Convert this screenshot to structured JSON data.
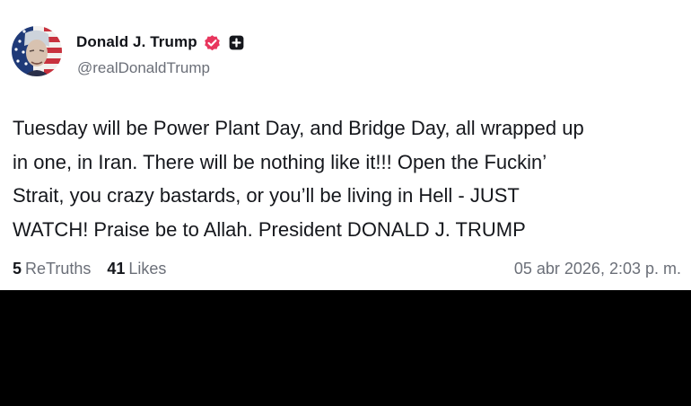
{
  "post": {
    "author": {
      "display_name": "Donald J. Trump",
      "handle": "@realDonaldTrump",
      "verified_icon": "verified-badge-icon",
      "follow_icon": "plus-icon"
    },
    "text": "Tuesday will be Power Plant Day, and Bridge Day, all wrapped up\nin one, in Iran. There will be nothing like it!!! Open the Fuckin’\nStrait, you crazy bastards, or you’ll be living in Hell - JUST\nWATCH! Praise be to Allah. President DONALD J. TRUMP",
    "stats": {
      "retruths_count": "5",
      "retruths_label": "ReTruths",
      "likes_count": "41",
      "likes_label": "Likes"
    },
    "timestamp": "05 abr 2026, 2:03 p. m."
  },
  "colors": {
    "verified_badge": "#e8365d",
    "text_primary": "#15171c",
    "text_secondary": "#6b6f78",
    "background": "#ffffff",
    "bottom_area": "#000000"
  }
}
